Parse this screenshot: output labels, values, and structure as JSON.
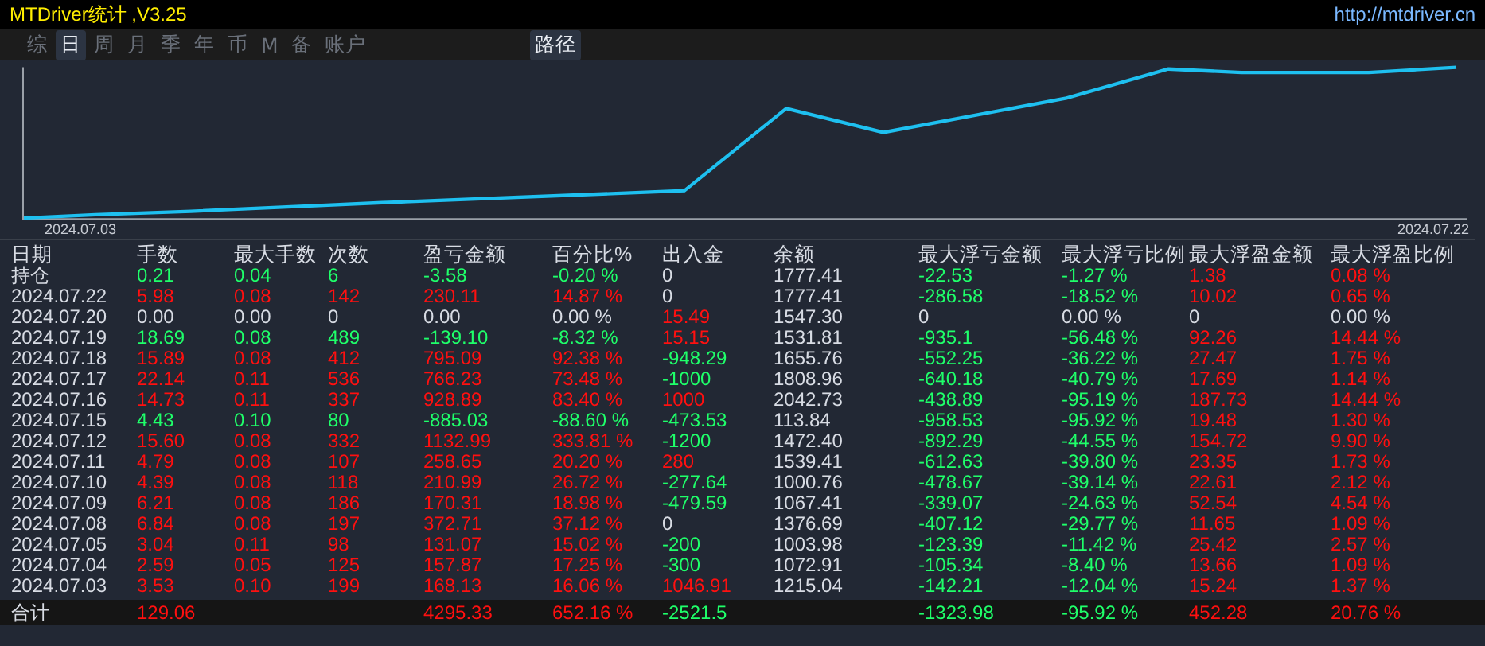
{
  "window": {
    "title": "MTDriver统计 ,V3.25",
    "link": "http://mtdriver.cn"
  },
  "tabs": [
    {
      "label": "综",
      "selected": false
    },
    {
      "label": "日",
      "selected": true
    },
    {
      "label": "周",
      "selected": false
    },
    {
      "label": "月",
      "selected": false
    },
    {
      "label": "季",
      "selected": false
    },
    {
      "label": "年",
      "selected": false
    },
    {
      "label": "币",
      "selected": false
    },
    {
      "label": "M",
      "selected": false
    },
    {
      "label": "备",
      "selected": false
    },
    {
      "label": "账户",
      "selected": false
    }
  ],
  "view_tab": {
    "label": "路径",
    "selected": true
  },
  "chart": {
    "start_label": "2024.07.03",
    "end_label": "2024.07.22"
  },
  "table": {
    "columns": [
      "日期",
      "手数",
      "最大手数",
      "次数",
      "盈亏金额",
      "百分比%",
      "出入金",
      "余额",
      "最大浮亏金额",
      "最大浮亏比例",
      "最大浮盈金额",
      "最大浮盈比例"
    ],
    "rows": [
      {
        "cells": [
          {
            "text": "持仓",
            "color": "#d8dce4"
          },
          {
            "text": "0.21",
            "color": "#1fff6a"
          },
          {
            "text": "0.04",
            "color": "#1fff6a"
          },
          {
            "text": "6",
            "color": "#1fff6a"
          },
          {
            "text": "-3.58",
            "color": "#1fff6a"
          },
          {
            "text": "-0.20 %",
            "color": "#1fff6a"
          },
          {
            "text": "0",
            "color": "#d8dce4"
          },
          {
            "text": "1777.41",
            "color": "#d8dce4"
          },
          {
            "text": "-22.53",
            "color": "#1fff6a"
          },
          {
            "text": "-1.27 %",
            "color": "#1fff6a"
          },
          {
            "text": "1.38",
            "color": "#ff1010"
          },
          {
            "text": "0.08 %",
            "color": "#ff1010"
          }
        ]
      },
      {
        "cells": [
          {
            "text": "2024.07.22",
            "color": "#d8dce4"
          },
          {
            "text": "5.98",
            "color": "#ff1010"
          },
          {
            "text": "0.08",
            "color": "#ff1010"
          },
          {
            "text": "142",
            "color": "#ff1010"
          },
          {
            "text": "230.11",
            "color": "#ff1010"
          },
          {
            "text": "14.87 %",
            "color": "#ff1010"
          },
          {
            "text": "0",
            "color": "#d8dce4"
          },
          {
            "text": "1777.41",
            "color": "#d8dce4"
          },
          {
            "text": "-286.58",
            "color": "#1fff6a"
          },
          {
            "text": "-18.52 %",
            "color": "#1fff6a"
          },
          {
            "text": "10.02",
            "color": "#ff1010"
          },
          {
            "text": "0.65 %",
            "color": "#ff1010"
          }
        ]
      },
      {
        "cells": [
          {
            "text": "2024.07.20",
            "color": "#d8dce4"
          },
          {
            "text": "0.00",
            "color": "#d8dce4"
          },
          {
            "text": "0.00",
            "color": "#d8dce4"
          },
          {
            "text": "0",
            "color": "#d8dce4"
          },
          {
            "text": "0.00",
            "color": "#d8dce4"
          },
          {
            "text": "0.00 %",
            "color": "#d8dce4"
          },
          {
            "text": "15.49",
            "color": "#ff1010"
          },
          {
            "text": "1547.30",
            "color": "#d8dce4"
          },
          {
            "text": "0",
            "color": "#d8dce4"
          },
          {
            "text": "0.00 %",
            "color": "#d8dce4"
          },
          {
            "text": "0",
            "color": "#d8dce4"
          },
          {
            "text": "0.00 %",
            "color": "#d8dce4"
          }
        ]
      },
      {
        "cells": [
          {
            "text": "2024.07.19",
            "color": "#d8dce4"
          },
          {
            "text": "18.69",
            "color": "#1fff6a"
          },
          {
            "text": "0.08",
            "color": "#1fff6a"
          },
          {
            "text": "489",
            "color": "#1fff6a"
          },
          {
            "text": "-139.10",
            "color": "#1fff6a"
          },
          {
            "text": "-8.32 %",
            "color": "#1fff6a"
          },
          {
            "text": "15.15",
            "color": "#ff1010"
          },
          {
            "text": "1531.81",
            "color": "#d8dce4"
          },
          {
            "text": "-935.1",
            "color": "#1fff6a"
          },
          {
            "text": "-56.48 %",
            "color": "#1fff6a"
          },
          {
            "text": "92.26",
            "color": "#ff1010"
          },
          {
            "text": "14.44 %",
            "color": "#ff1010"
          }
        ]
      },
      {
        "cells": [
          {
            "text": "2024.07.18",
            "color": "#d8dce4"
          },
          {
            "text": "15.89",
            "color": "#ff1010"
          },
          {
            "text": "0.08",
            "color": "#ff1010"
          },
          {
            "text": "412",
            "color": "#ff1010"
          },
          {
            "text": "795.09",
            "color": "#ff1010"
          },
          {
            "text": "92.38 %",
            "color": "#ff1010"
          },
          {
            "text": "-948.29",
            "color": "#1fff6a"
          },
          {
            "text": "1655.76",
            "color": "#d8dce4"
          },
          {
            "text": "-552.25",
            "color": "#1fff6a"
          },
          {
            "text": "-36.22 %",
            "color": "#1fff6a"
          },
          {
            "text": "27.47",
            "color": "#ff1010"
          },
          {
            "text": "1.75 %",
            "color": "#ff1010"
          }
        ]
      },
      {
        "cells": [
          {
            "text": "2024.07.17",
            "color": "#d8dce4"
          },
          {
            "text": "22.14",
            "color": "#ff1010"
          },
          {
            "text": "0.11",
            "color": "#ff1010"
          },
          {
            "text": "536",
            "color": "#ff1010"
          },
          {
            "text": "766.23",
            "color": "#ff1010"
          },
          {
            "text": "73.48 %",
            "color": "#ff1010"
          },
          {
            "text": "-1000",
            "color": "#1fff6a"
          },
          {
            "text": "1808.96",
            "color": "#d8dce4"
          },
          {
            "text": "-640.18",
            "color": "#1fff6a"
          },
          {
            "text": "-40.79 %",
            "color": "#1fff6a"
          },
          {
            "text": "17.69",
            "color": "#ff1010"
          },
          {
            "text": "1.14 %",
            "color": "#ff1010"
          }
        ]
      },
      {
        "cells": [
          {
            "text": "2024.07.16",
            "color": "#d8dce4"
          },
          {
            "text": "14.73",
            "color": "#ff1010"
          },
          {
            "text": "0.11",
            "color": "#ff1010"
          },
          {
            "text": "337",
            "color": "#ff1010"
          },
          {
            "text": "928.89",
            "color": "#ff1010"
          },
          {
            "text": "83.40 %",
            "color": "#ff1010"
          },
          {
            "text": "1000",
            "color": "#ff1010"
          },
          {
            "text": "2042.73",
            "color": "#d8dce4"
          },
          {
            "text": "-438.89",
            "color": "#1fff6a"
          },
          {
            "text": "-95.19 %",
            "color": "#1fff6a"
          },
          {
            "text": "187.73",
            "color": "#ff1010"
          },
          {
            "text": "14.44 %",
            "color": "#ff1010"
          }
        ]
      },
      {
        "cells": [
          {
            "text": "2024.07.15",
            "color": "#d8dce4"
          },
          {
            "text": "4.43",
            "color": "#1fff6a"
          },
          {
            "text": "0.10",
            "color": "#1fff6a"
          },
          {
            "text": "80",
            "color": "#1fff6a"
          },
          {
            "text": "-885.03",
            "color": "#1fff6a"
          },
          {
            "text": "-88.60 %",
            "color": "#1fff6a"
          },
          {
            "text": "-473.53",
            "color": "#1fff6a"
          },
          {
            "text": "113.84",
            "color": "#d8dce4"
          },
          {
            "text": "-958.53",
            "color": "#1fff6a"
          },
          {
            "text": "-95.92 %",
            "color": "#1fff6a"
          },
          {
            "text": "19.48",
            "color": "#ff1010"
          },
          {
            "text": "1.30 %",
            "color": "#ff1010"
          }
        ]
      },
      {
        "cells": [
          {
            "text": "2024.07.12",
            "color": "#d8dce4"
          },
          {
            "text": "15.60",
            "color": "#ff1010"
          },
          {
            "text": "0.08",
            "color": "#ff1010"
          },
          {
            "text": "332",
            "color": "#ff1010"
          },
          {
            "text": "1132.99",
            "color": "#ff1010"
          },
          {
            "text": "333.81 %",
            "color": "#ff1010"
          },
          {
            "text": "-1200",
            "color": "#1fff6a"
          },
          {
            "text": "1472.40",
            "color": "#d8dce4"
          },
          {
            "text": "-892.29",
            "color": "#1fff6a"
          },
          {
            "text": "-44.55 %",
            "color": "#1fff6a"
          },
          {
            "text": "154.72",
            "color": "#ff1010"
          },
          {
            "text": "9.90 %",
            "color": "#ff1010"
          }
        ]
      },
      {
        "cells": [
          {
            "text": "2024.07.11",
            "color": "#d8dce4"
          },
          {
            "text": "4.79",
            "color": "#ff1010"
          },
          {
            "text": "0.08",
            "color": "#ff1010"
          },
          {
            "text": "107",
            "color": "#ff1010"
          },
          {
            "text": "258.65",
            "color": "#ff1010"
          },
          {
            "text": "20.20 %",
            "color": "#ff1010"
          },
          {
            "text": "280",
            "color": "#ff1010"
          },
          {
            "text": "1539.41",
            "color": "#d8dce4"
          },
          {
            "text": "-612.63",
            "color": "#1fff6a"
          },
          {
            "text": "-39.80 %",
            "color": "#1fff6a"
          },
          {
            "text": "23.35",
            "color": "#ff1010"
          },
          {
            "text": "1.73 %",
            "color": "#ff1010"
          }
        ]
      },
      {
        "cells": [
          {
            "text": "2024.07.10",
            "color": "#d8dce4"
          },
          {
            "text": "4.39",
            "color": "#ff1010"
          },
          {
            "text": "0.08",
            "color": "#ff1010"
          },
          {
            "text": "118",
            "color": "#ff1010"
          },
          {
            "text": "210.99",
            "color": "#ff1010"
          },
          {
            "text": "26.72 %",
            "color": "#ff1010"
          },
          {
            "text": "-277.64",
            "color": "#1fff6a"
          },
          {
            "text": "1000.76",
            "color": "#d8dce4"
          },
          {
            "text": "-478.67",
            "color": "#1fff6a"
          },
          {
            "text": "-39.14 %",
            "color": "#1fff6a"
          },
          {
            "text": "22.61",
            "color": "#ff1010"
          },
          {
            "text": "2.12 %",
            "color": "#ff1010"
          }
        ]
      },
      {
        "cells": [
          {
            "text": "2024.07.09",
            "color": "#d8dce4"
          },
          {
            "text": "6.21",
            "color": "#ff1010"
          },
          {
            "text": "0.08",
            "color": "#ff1010"
          },
          {
            "text": "186",
            "color": "#ff1010"
          },
          {
            "text": "170.31",
            "color": "#ff1010"
          },
          {
            "text": "18.98 %",
            "color": "#ff1010"
          },
          {
            "text": "-479.59",
            "color": "#1fff6a"
          },
          {
            "text": "1067.41",
            "color": "#d8dce4"
          },
          {
            "text": "-339.07",
            "color": "#1fff6a"
          },
          {
            "text": "-24.63 %",
            "color": "#1fff6a"
          },
          {
            "text": "52.54",
            "color": "#ff1010"
          },
          {
            "text": "4.54 %",
            "color": "#ff1010"
          }
        ]
      },
      {
        "cells": [
          {
            "text": "2024.07.08",
            "color": "#d8dce4"
          },
          {
            "text": "6.84",
            "color": "#ff1010"
          },
          {
            "text": "0.08",
            "color": "#ff1010"
          },
          {
            "text": "197",
            "color": "#ff1010"
          },
          {
            "text": "372.71",
            "color": "#ff1010"
          },
          {
            "text": "37.12 %",
            "color": "#ff1010"
          },
          {
            "text": "0",
            "color": "#d8dce4"
          },
          {
            "text": "1376.69",
            "color": "#d8dce4"
          },
          {
            "text": "-407.12",
            "color": "#1fff6a"
          },
          {
            "text": "-29.77 %",
            "color": "#1fff6a"
          },
          {
            "text": "11.65",
            "color": "#ff1010"
          },
          {
            "text": "1.09 %",
            "color": "#ff1010"
          }
        ]
      },
      {
        "cells": [
          {
            "text": "2024.07.05",
            "color": "#d8dce4"
          },
          {
            "text": "3.04",
            "color": "#ff1010"
          },
          {
            "text": "0.11",
            "color": "#ff1010"
          },
          {
            "text": "98",
            "color": "#ff1010"
          },
          {
            "text": "131.07",
            "color": "#ff1010"
          },
          {
            "text": "15.02 %",
            "color": "#ff1010"
          },
          {
            "text": "-200",
            "color": "#1fff6a"
          },
          {
            "text": "1003.98",
            "color": "#d8dce4"
          },
          {
            "text": "-123.39",
            "color": "#1fff6a"
          },
          {
            "text": "-11.42 %",
            "color": "#1fff6a"
          },
          {
            "text": "25.42",
            "color": "#ff1010"
          },
          {
            "text": "2.57 %",
            "color": "#ff1010"
          }
        ]
      },
      {
        "cells": [
          {
            "text": "2024.07.04",
            "color": "#d8dce4"
          },
          {
            "text": "2.59",
            "color": "#ff1010"
          },
          {
            "text": "0.05",
            "color": "#ff1010"
          },
          {
            "text": "125",
            "color": "#ff1010"
          },
          {
            "text": "157.87",
            "color": "#ff1010"
          },
          {
            "text": "17.25 %",
            "color": "#ff1010"
          },
          {
            "text": "-300",
            "color": "#1fff6a"
          },
          {
            "text": "1072.91",
            "color": "#d8dce4"
          },
          {
            "text": "-105.34",
            "color": "#1fff6a"
          },
          {
            "text": "-8.40 %",
            "color": "#1fff6a"
          },
          {
            "text": "13.66",
            "color": "#ff1010"
          },
          {
            "text": "1.09 %",
            "color": "#ff1010"
          }
        ]
      },
      {
        "cells": [
          {
            "text": "2024.07.03",
            "color": "#d8dce4"
          },
          {
            "text": "3.53",
            "color": "#ff1010"
          },
          {
            "text": "0.10",
            "color": "#ff1010"
          },
          {
            "text": "199",
            "color": "#ff1010"
          },
          {
            "text": "168.13",
            "color": "#ff1010"
          },
          {
            "text": "16.06 %",
            "color": "#ff1010"
          },
          {
            "text": "1046.91",
            "color": "#ff1010"
          },
          {
            "text": "1215.04",
            "color": "#d8dce4"
          },
          {
            "text": "-142.21",
            "color": "#1fff6a"
          },
          {
            "text": "-12.04 %",
            "color": "#1fff6a"
          },
          {
            "text": "15.24",
            "color": "#ff1010"
          },
          {
            "text": "1.37 %",
            "color": "#ff1010"
          }
        ]
      }
    ],
    "total": {
      "label": {
        "text": "合计",
        "color": "#d8dce4"
      },
      "lots": {
        "text": "129.06",
        "color": "#ff1010"
      },
      "profit": {
        "text": "4295.33",
        "color": "#ff1010"
      },
      "percent": {
        "text": "652.16 %",
        "color": "#ff1010"
      },
      "deposits": {
        "text": "-2521.5",
        "color": "#1fff6a"
      },
      "max_float_loss": {
        "text": "-1323.98",
        "color": "#1fff6a"
      },
      "max_float_loss_ratio": {
        "text": "-95.92 %",
        "color": "#1fff6a"
      },
      "max_float_profit": {
        "text": "452.28",
        "color": "#ff1010"
      },
      "max_float_profit_ratio": {
        "text": "20.76 %",
        "color": "#ff1010"
      }
    }
  }
}
